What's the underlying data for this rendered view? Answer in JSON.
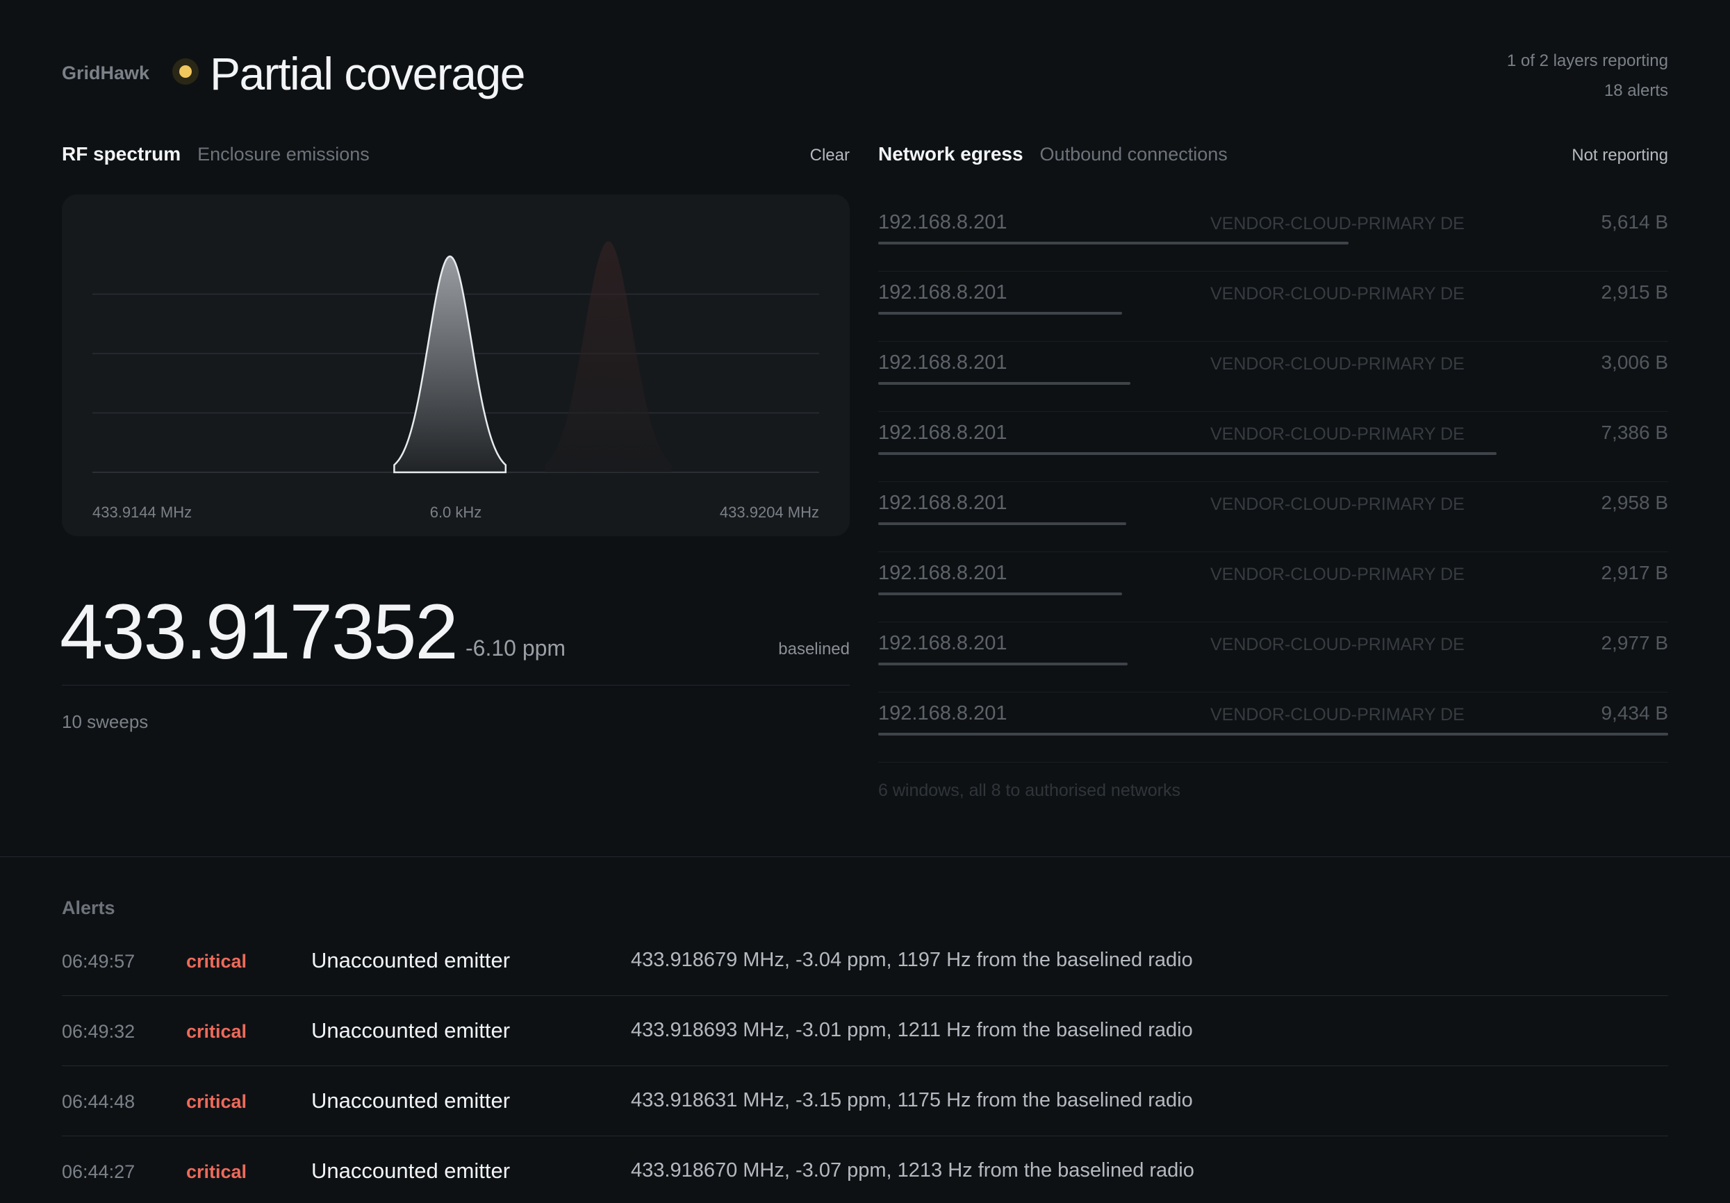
{
  "header": {
    "brand": "GridHawk",
    "title": "Partial coverage",
    "status_color": "#f0c75e",
    "layers_reporting": "1 of 2 layers reporting",
    "alerts_count": "18 alerts"
  },
  "rf": {
    "title": "RF spectrum",
    "subtitle": "Enclosure emissions",
    "status": "Clear",
    "frequency": "433.917352",
    "ppm": "-6.10 ppm",
    "state": "baselined",
    "sweeps": "10 sweeps"
  },
  "chart_data": {
    "type": "area",
    "title": "",
    "xlabel": "",
    "ylabel": "",
    "x_tick_labels": [
      "433.9144 MHz",
      "6.0 kHz",
      "433.9204 MHz"
    ],
    "xlim": [
      433.9144,
      433.9204
    ],
    "ylim": [
      0,
      1.1
    ],
    "grid": true,
    "series": [
      {
        "peak_mhz": 433.917352,
        "height": 1.0,
        "width_mhz": 0.00046,
        "color": "#e9ecef"
      },
      {
        "peak_mhz": 433.91866,
        "height": 1.07,
        "width_mhz": 0.00052,
        "color": "#3a2424"
      }
    ]
  },
  "egress": {
    "title": "Network egress",
    "subtitle": "Outbound connections",
    "status": "Not reporting",
    "rows": [
      {
        "ip": "192.168.8.201",
        "network": "VENDOR-CLOUD-PRIMARY DE",
        "bytes": "5,614 B",
        "fraction": 0.595
      },
      {
        "ip": "192.168.8.201",
        "network": "VENDOR-CLOUD-PRIMARY DE",
        "bytes": "2,915 B",
        "fraction": 0.309
      },
      {
        "ip": "192.168.8.201",
        "network": "VENDOR-CLOUD-PRIMARY DE",
        "bytes": "3,006 B",
        "fraction": 0.319
      },
      {
        "ip": "192.168.8.201",
        "network": "VENDOR-CLOUD-PRIMARY DE",
        "bytes": "7,386 B",
        "fraction": 0.783
      },
      {
        "ip": "192.168.8.201",
        "network": "VENDOR-CLOUD-PRIMARY DE",
        "bytes": "2,958 B",
        "fraction": 0.314
      },
      {
        "ip": "192.168.8.201",
        "network": "VENDOR-CLOUD-PRIMARY DE",
        "bytes": "2,917 B",
        "fraction": 0.309
      },
      {
        "ip": "192.168.8.201",
        "network": "VENDOR-CLOUD-PRIMARY DE",
        "bytes": "2,977 B",
        "fraction": 0.316
      },
      {
        "ip": "192.168.8.201",
        "network": "VENDOR-CLOUD-PRIMARY DE",
        "bytes": "9,434 B",
        "fraction": 1.0
      }
    ],
    "footer": "6 windows, all 8 to authorised networks"
  },
  "alerts": {
    "title": "Alerts",
    "severity_color": "#ef6a5a",
    "rows": [
      {
        "time": "06:49:57",
        "severity": "critical",
        "title": "Unaccounted emitter",
        "detail": "433.918679 MHz, -3.04 ppm, 1197 Hz from the baselined radio"
      },
      {
        "time": "06:49:32",
        "severity": "critical",
        "title": "Unaccounted emitter",
        "detail": "433.918693 MHz, -3.01 ppm, 1211 Hz from the baselined radio"
      },
      {
        "time": "06:44:48",
        "severity": "critical",
        "title": "Unaccounted emitter",
        "detail": "433.918631 MHz, -3.15 ppm, 1175 Hz from the baselined radio"
      },
      {
        "time": "06:44:27",
        "severity": "critical",
        "title": "Unaccounted emitter",
        "detail": "433.918670 MHz, -3.07 ppm, 1213 Hz from the baselined radio"
      }
    ]
  }
}
